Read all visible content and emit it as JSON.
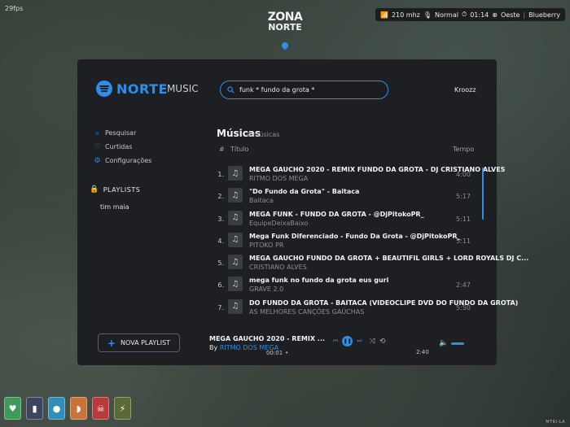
{
  "hud": {
    "fps": "29fps",
    "logo_line1": "ZONA",
    "logo_line2": "NORTE",
    "radio": "210 mhz",
    "voice_mode": "Normal",
    "time": "01:14",
    "location": "Oeste",
    "location_sep": "|",
    "server": "Blueberry",
    "corner_tag": "MTKI-LA"
  },
  "app": {
    "brand_word1": "NORTE",
    "brand_word2": "MUSIC",
    "search": {
      "value": "funk * fundo da grota *",
      "placeholder": ""
    },
    "user": "Kroozz",
    "nav": [
      {
        "icon": "search-icon",
        "label": "Pesquisar"
      },
      {
        "icon": "heart-icon",
        "label": "Curtidas"
      },
      {
        "icon": "gear-icon",
        "label": "Configurações"
      }
    ],
    "playlists_header": "PLAYLISTS",
    "playlists": [
      "tim maia"
    ],
    "new_playlist_label": "NOVA PLAYLIST",
    "section_title": "Músicas",
    "section_count": "0 músicas",
    "columns": {
      "num": "#",
      "title": "Título",
      "time": "Tempo"
    },
    "tracks": [
      {
        "num": "1.",
        "title": "MEGA GAUCHO 2020 - REMIX FUNDO DA GROTA - DJ CRISTIANO ALVES",
        "artist": "RITMO DOS MEGA",
        "duration": "4:00"
      },
      {
        "num": "2.",
        "title": "\"Do Fundo da Grota\" - Baitaca",
        "artist": "Baitaca",
        "duration": "5:17"
      },
      {
        "num": "3.",
        "title": "MEGA FUNK - FUNDO DA GROTA - @DjPitokoPR_",
        "artist": "EquipeDeixaBaixo",
        "duration": "5:11"
      },
      {
        "num": "4.",
        "title": "Mega Funk Diferenciado - Fundo Da Grota - @DjPitokoPR_",
        "artist": "PITOKO PR",
        "duration": "5:11"
      },
      {
        "num": "5.",
        "title": "MEGA GAUCHO FUNDO DA GROTA + BEAUTIFIL GIRLS + LORD ROYALS DJ C...",
        "artist": "CRISTIANO ALVES",
        "duration": ""
      },
      {
        "num": "6.",
        "title": "mega funk no fundo da grota eus guri",
        "artist": "GRAVE 2.0",
        "duration": "2:47"
      },
      {
        "num": "7.",
        "title": "DO FUNDO DA GROTA - BAITACA (VIDEOCLIPE DVD DO FUNDO DA GROTA)",
        "artist": "AS MELHORES CANÇÕES GAÚCHAS",
        "duration": "5:50"
      }
    ],
    "player": {
      "title": "MEGA GAUCHO 2020 - REMIX ...",
      "by_label": "By",
      "artist": "RITMO DOS MEGA",
      "current_time": "00:01",
      "total_time": "2:40",
      "volume": 0.7
    }
  },
  "hotbar": [
    {
      "icon": "heart-icon",
      "color": "#3f9a5a"
    },
    {
      "icon": "bottle-icon",
      "color": "#3d4660"
    },
    {
      "icon": "water-drop-icon",
      "color": "#2f8fb8"
    },
    {
      "icon": "food-icon",
      "color": "#c8733a"
    },
    {
      "icon": "skull-icon",
      "color": "#b83a3a"
    },
    {
      "icon": "lightning-icon",
      "color": "#5a6a36"
    }
  ],
  "colors": {
    "accent": "#2f8ee8",
    "panel": "#1d1f22"
  }
}
